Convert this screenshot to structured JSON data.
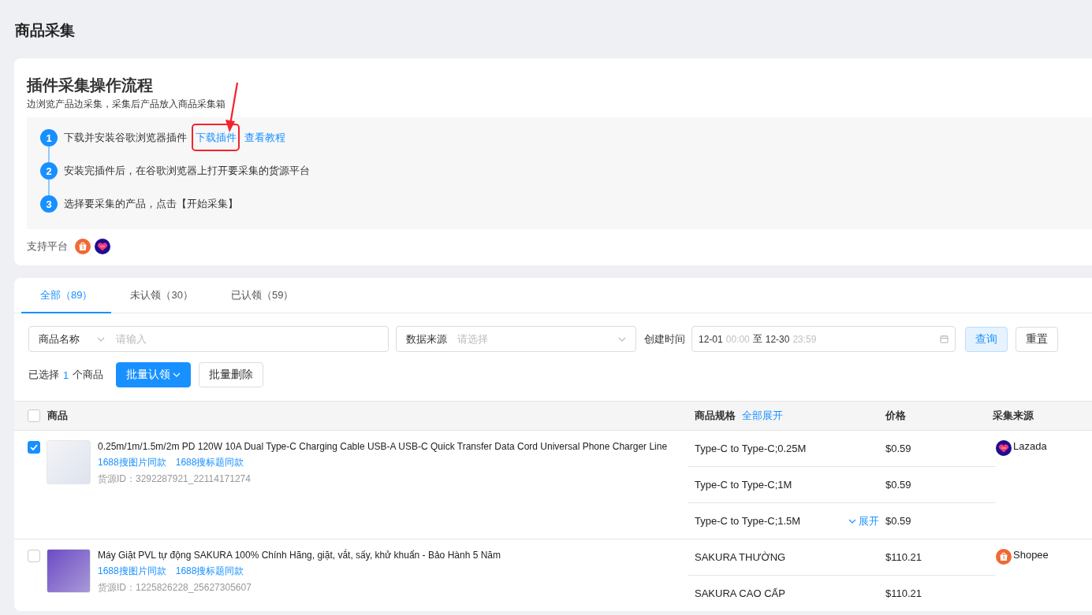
{
  "page_title": "商品采集",
  "guide": {
    "title": "插件采集操作流程",
    "subtitle": "边浏览产品边采集，采集后产品放入商品采集箱",
    "steps": [
      {
        "number": "1",
        "text": "下载并安装谷歌浏览器插件",
        "links": [
          {
            "text": "下载插件",
            "highlighted": true
          },
          {
            "text": "查看教程",
            "highlighted": false
          }
        ]
      },
      {
        "number": "2",
        "text": "安装完插件后，在谷歌浏览器上打开要采集的货源平台"
      },
      {
        "number": "3",
        "text": "选择要采集的产品，点击【开始采集】"
      }
    ],
    "platforms_label": "支持平台",
    "platforms": [
      {
        "kind": "shopee"
      },
      {
        "kind": "lazada"
      }
    ]
  },
  "tabs": [
    {
      "label": "全部（89）",
      "selected": true
    },
    {
      "label": "未认领（30）",
      "selected": false
    },
    {
      "label": "已认领（59）",
      "selected": false
    }
  ],
  "filters": {
    "field_select": "商品名称",
    "search_placeholder": "请输入",
    "source_label": "数据来源",
    "source_placeholder": "请选择",
    "date_label": "创建时间",
    "date_start": "12-01",
    "time_start": "00:00",
    "date_sep": "至",
    "date_end": "12-30",
    "time_end": "23:59",
    "query_button": "查询",
    "reset_button": "重置"
  },
  "selection": {
    "prefix": "已选择",
    "count": "1",
    "suffix": "个商品"
  },
  "bulk_buttons": [
    {
      "label": "批量认领",
      "kind": "primary-dropdown"
    },
    {
      "label": "批量删除",
      "kind": "default"
    }
  ],
  "table": {
    "select_all_checked": false,
    "columns": [
      "商品",
      "商品规格",
      "价格",
      "采集来源"
    ],
    "expand_all": "全部展开",
    "rows": [
      {
        "checked": true,
        "title": "0.25m/1m/1.5m/2m PD 120W 10A Dual Type-C Charging Cable USB-A USB-C Quick Transfer Data Cord Universal Phone Charger Line",
        "links": [
          "1688搜图片同款",
          "1688搜标题同款"
        ],
        "source_id": "货源ID：3292287921_22114171274",
        "variants": [
          {
            "spec": "Type-C to Type-C;0.25M",
            "price": "$0.59"
          },
          {
            "spec": "Type-C to Type-C;1M",
            "price": "$0.59"
          },
          {
            "spec": "Type-C to Type-C;1.5M",
            "price": "$0.59"
          }
        ],
        "more_label": "展开",
        "source": {
          "kind": "lazada",
          "name": "Lazada"
        }
      },
      {
        "checked": false,
        "title": "Máy Giặt PVL tự động SAKURA 100% Chính Hãng, giặt, vắt, sấy, khử khuẩn - Bảo Hành 5 Năm",
        "links": [
          "1688搜图片同款",
          "1688搜标题同款"
        ],
        "source_id": "货源ID：1225826228_25627305607",
        "variants": [
          {
            "spec": "SAKURA THƯỜNG",
            "price": "$110.21"
          },
          {
            "spec": "SAKURA CAO CẤP",
            "price": "$110.21"
          }
        ],
        "source": {
          "kind": "shopee",
          "name": "Shopee"
        }
      }
    ]
  }
}
